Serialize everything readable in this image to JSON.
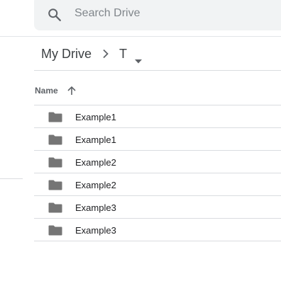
{
  "search": {
    "placeholder": "Search Drive",
    "icon": "search-icon"
  },
  "breadcrumb": {
    "root_label": "My Drive",
    "separator_icon": "chevron-right-icon",
    "current_label": "T",
    "dropdown_icon": "caret-down-icon"
  },
  "list_header": {
    "name_label": "Name",
    "sort_icon": "arrow-up-icon",
    "sort_direction": "ascending"
  },
  "files": [
    {
      "name": "Example1",
      "icon": "folder-icon"
    },
    {
      "name": "Example1",
      "icon": "folder-icon"
    },
    {
      "name": "Example2",
      "icon": "folder-icon"
    },
    {
      "name": "Example2",
      "icon": "folder-icon"
    },
    {
      "name": "Example3",
      "icon": "folder-icon"
    },
    {
      "name": "Example3",
      "icon": "folder-icon"
    }
  ],
  "colors": {
    "search_bg": "#f1f3f4",
    "divider": "#dadce0",
    "icon_gray": "#5f6368",
    "folder_gray": "#757575",
    "text": "#202124"
  }
}
